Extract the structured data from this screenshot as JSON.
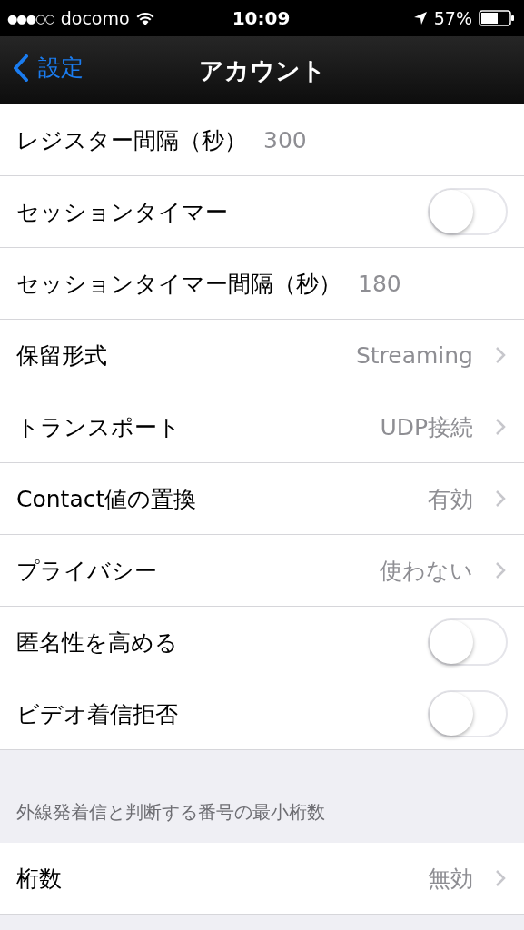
{
  "status_bar": {
    "signal": "●●●○○",
    "carrier": "docomo",
    "time": "10:09",
    "battery_percent": "57%"
  },
  "nav": {
    "back": "設定",
    "title": "アカウント"
  },
  "rows": [
    {
      "kind": "value",
      "label": "レジスター間隔（秒）",
      "value": "300"
    },
    {
      "kind": "toggle",
      "label": "セッションタイマー",
      "on": false
    },
    {
      "kind": "value",
      "label": "セッションタイマー間隔（秒）",
      "value": "180"
    },
    {
      "kind": "disclosure",
      "label": "保留形式",
      "value": "Streaming"
    },
    {
      "kind": "disclosure",
      "label": "トランスポート",
      "value": "UDP接続"
    },
    {
      "kind": "disclosure",
      "label": "Contact値の置換",
      "value": "有効"
    },
    {
      "kind": "disclosure",
      "label": "プライバシー",
      "value": "使わない"
    },
    {
      "kind": "toggle",
      "label": "匿名性を高める",
      "on": false
    },
    {
      "kind": "toggle",
      "label": "ビデオ着信拒否",
      "on": false
    }
  ],
  "section": {
    "header": "外線発着信と判断する番号の最小桁数",
    "rows": [
      {
        "kind": "disclosure",
        "label": "桁数",
        "value": "無効"
      }
    ]
  }
}
